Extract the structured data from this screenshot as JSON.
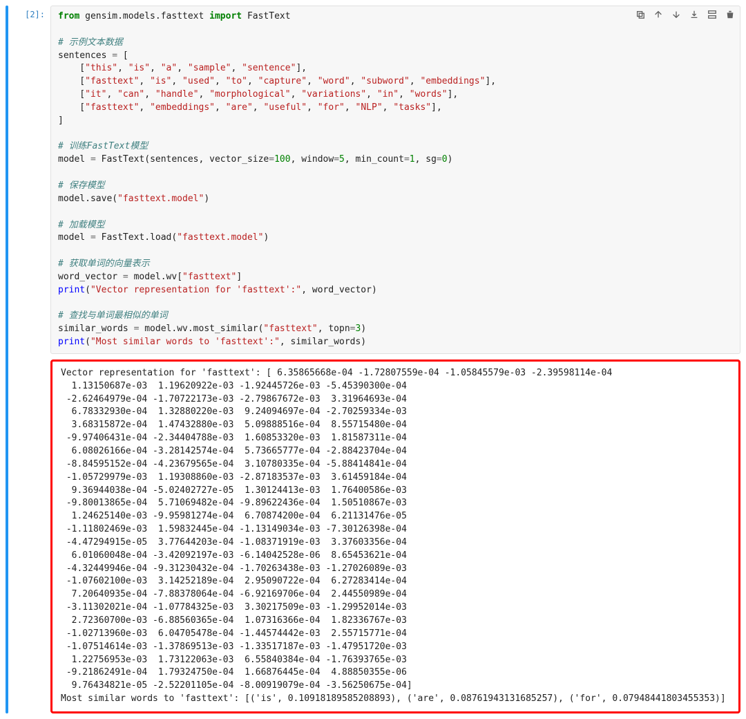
{
  "cell": {
    "prompt": "[2]:",
    "code_tokens": [
      {
        "t": "from",
        "c": "k-kw"
      },
      {
        "t": " gensim.models.fasttext ",
        "c": ""
      },
      {
        "t": "import",
        "c": "k-kw"
      },
      {
        "t": " FastText",
        "c": ""
      },
      {
        "t": "\n",
        "c": ""
      },
      {
        "t": "\n",
        "c": ""
      },
      {
        "t": "# 示例文本数据",
        "c": "k-com"
      },
      {
        "t": "\n",
        "c": ""
      },
      {
        "t": "sentences ",
        "c": ""
      },
      {
        "t": "=",
        "c": "k-op"
      },
      {
        "t": " [",
        "c": ""
      },
      {
        "t": "\n",
        "c": ""
      },
      {
        "t": "    [",
        "c": ""
      },
      {
        "t": "\"this\"",
        "c": "k-str"
      },
      {
        "t": ", ",
        "c": ""
      },
      {
        "t": "\"is\"",
        "c": "k-str"
      },
      {
        "t": ", ",
        "c": ""
      },
      {
        "t": "\"a\"",
        "c": "k-str"
      },
      {
        "t": ", ",
        "c": ""
      },
      {
        "t": "\"sample\"",
        "c": "k-str"
      },
      {
        "t": ", ",
        "c": ""
      },
      {
        "t": "\"sentence\"",
        "c": "k-str"
      },
      {
        "t": "],",
        "c": ""
      },
      {
        "t": "\n",
        "c": ""
      },
      {
        "t": "    [",
        "c": ""
      },
      {
        "t": "\"fasttext\"",
        "c": "k-str"
      },
      {
        "t": ", ",
        "c": ""
      },
      {
        "t": "\"is\"",
        "c": "k-str"
      },
      {
        "t": ", ",
        "c": ""
      },
      {
        "t": "\"used\"",
        "c": "k-str"
      },
      {
        "t": ", ",
        "c": ""
      },
      {
        "t": "\"to\"",
        "c": "k-str"
      },
      {
        "t": ", ",
        "c": ""
      },
      {
        "t": "\"capture\"",
        "c": "k-str"
      },
      {
        "t": ", ",
        "c": ""
      },
      {
        "t": "\"word\"",
        "c": "k-str"
      },
      {
        "t": ", ",
        "c": ""
      },
      {
        "t": "\"subword\"",
        "c": "k-str"
      },
      {
        "t": ", ",
        "c": ""
      },
      {
        "t": "\"embeddings\"",
        "c": "k-str"
      },
      {
        "t": "],",
        "c": ""
      },
      {
        "t": "\n",
        "c": ""
      },
      {
        "t": "    [",
        "c": ""
      },
      {
        "t": "\"it\"",
        "c": "k-str"
      },
      {
        "t": ", ",
        "c": ""
      },
      {
        "t": "\"can\"",
        "c": "k-str"
      },
      {
        "t": ", ",
        "c": ""
      },
      {
        "t": "\"handle\"",
        "c": "k-str"
      },
      {
        "t": ", ",
        "c": ""
      },
      {
        "t": "\"morphological\"",
        "c": "k-str"
      },
      {
        "t": ", ",
        "c": ""
      },
      {
        "t": "\"variations\"",
        "c": "k-str"
      },
      {
        "t": ", ",
        "c": ""
      },
      {
        "t": "\"in\"",
        "c": "k-str"
      },
      {
        "t": ", ",
        "c": ""
      },
      {
        "t": "\"words\"",
        "c": "k-str"
      },
      {
        "t": "],",
        "c": ""
      },
      {
        "t": "\n",
        "c": ""
      },
      {
        "t": "    [",
        "c": ""
      },
      {
        "t": "\"fasttext\"",
        "c": "k-str"
      },
      {
        "t": ", ",
        "c": ""
      },
      {
        "t": "\"embeddings\"",
        "c": "k-str"
      },
      {
        "t": ", ",
        "c": ""
      },
      {
        "t": "\"are\"",
        "c": "k-str"
      },
      {
        "t": ", ",
        "c": ""
      },
      {
        "t": "\"useful\"",
        "c": "k-str"
      },
      {
        "t": ", ",
        "c": ""
      },
      {
        "t": "\"for\"",
        "c": "k-str"
      },
      {
        "t": ", ",
        "c": ""
      },
      {
        "t": "\"NLP\"",
        "c": "k-str"
      },
      {
        "t": ", ",
        "c": ""
      },
      {
        "t": "\"tasks\"",
        "c": "k-str"
      },
      {
        "t": "],",
        "c": ""
      },
      {
        "t": "\n",
        "c": ""
      },
      {
        "t": "]",
        "c": ""
      },
      {
        "t": "\n",
        "c": ""
      },
      {
        "t": "\n",
        "c": ""
      },
      {
        "t": "# 训练FastText模型",
        "c": "k-com"
      },
      {
        "t": "\n",
        "c": ""
      },
      {
        "t": "model ",
        "c": ""
      },
      {
        "t": "=",
        "c": "k-op"
      },
      {
        "t": " FastText(sentences, vector_size",
        "c": ""
      },
      {
        "t": "=",
        "c": "k-op"
      },
      {
        "t": "100",
        "c": "k-num"
      },
      {
        "t": ", window",
        "c": ""
      },
      {
        "t": "=",
        "c": "k-op"
      },
      {
        "t": "5",
        "c": "k-num"
      },
      {
        "t": ", min_count",
        "c": ""
      },
      {
        "t": "=",
        "c": "k-op"
      },
      {
        "t": "1",
        "c": "k-num"
      },
      {
        "t": ", sg",
        "c": ""
      },
      {
        "t": "=",
        "c": "k-op"
      },
      {
        "t": "0",
        "c": "k-num"
      },
      {
        "t": ")",
        "c": ""
      },
      {
        "t": "\n",
        "c": ""
      },
      {
        "t": "\n",
        "c": ""
      },
      {
        "t": "# 保存模型",
        "c": "k-com"
      },
      {
        "t": "\n",
        "c": ""
      },
      {
        "t": "model.save(",
        "c": ""
      },
      {
        "t": "\"fasttext.model\"",
        "c": "k-str"
      },
      {
        "t": ")",
        "c": ""
      },
      {
        "t": "\n",
        "c": ""
      },
      {
        "t": "\n",
        "c": ""
      },
      {
        "t": "# 加载模型",
        "c": "k-com"
      },
      {
        "t": "\n",
        "c": ""
      },
      {
        "t": "model ",
        "c": ""
      },
      {
        "t": "=",
        "c": "k-op"
      },
      {
        "t": " FastText.load(",
        "c": ""
      },
      {
        "t": "\"fasttext.model\"",
        "c": "k-str"
      },
      {
        "t": ")",
        "c": ""
      },
      {
        "t": "\n",
        "c": ""
      },
      {
        "t": "\n",
        "c": ""
      },
      {
        "t": "# 获取单词的向量表示",
        "c": "k-com"
      },
      {
        "t": "\n",
        "c": ""
      },
      {
        "t": "word_vector ",
        "c": ""
      },
      {
        "t": "=",
        "c": "k-op"
      },
      {
        "t": " model.wv[",
        "c": ""
      },
      {
        "t": "\"fasttext\"",
        "c": "k-str"
      },
      {
        "t": "]",
        "c": ""
      },
      {
        "t": "\n",
        "c": ""
      },
      {
        "t": "print",
        "c": "k-fn"
      },
      {
        "t": "(",
        "c": ""
      },
      {
        "t": "\"Vector representation for 'fasttext':\"",
        "c": "k-str"
      },
      {
        "t": ", word_vector)",
        "c": ""
      },
      {
        "t": "\n",
        "c": ""
      },
      {
        "t": "\n",
        "c": ""
      },
      {
        "t": "# 查找与单词最相似的单词",
        "c": "k-com"
      },
      {
        "t": "\n",
        "c": ""
      },
      {
        "t": "similar_words ",
        "c": ""
      },
      {
        "t": "=",
        "c": "k-op"
      },
      {
        "t": " model.wv.most_similar(",
        "c": ""
      },
      {
        "t": "\"fasttext\"",
        "c": "k-str"
      },
      {
        "t": ", topn",
        "c": ""
      },
      {
        "t": "=",
        "c": "k-op"
      },
      {
        "t": "3",
        "c": "k-num"
      },
      {
        "t": ")",
        "c": ""
      },
      {
        "t": "\n",
        "c": ""
      },
      {
        "t": "print",
        "c": "k-fn"
      },
      {
        "t": "(",
        "c": ""
      },
      {
        "t": "\"Most similar words to 'fasttext':\"",
        "c": "k-str"
      },
      {
        "t": ", similar_words)",
        "c": ""
      }
    ],
    "output": "Vector representation for 'fasttext': [ 6.35865668e-04 -1.72807559e-04 -1.05845579e-03 -2.39598114e-04\n  1.13150687e-03  1.19620922e-03 -1.92445726e-03 -5.45390300e-04\n -2.62464979e-04 -1.70722173e-03 -2.79867672e-03  3.31964693e-04\n  6.78332930e-04  1.32880220e-03  9.24094697e-04 -2.70259334e-03\n  3.68315872e-04  1.47432880e-03  5.09888516e-04  8.55715480e-04\n -9.97406431e-04 -2.34404788e-03  1.60853320e-03  1.81587311e-04\n  6.08026166e-04 -3.28142574e-04  5.73665777e-04 -2.88423704e-04\n -8.84595152e-04 -4.23679565e-04  3.10780335e-04 -5.88414841e-04\n -1.05729979e-03  1.19308860e-03 -2.87183537e-03  3.61459184e-04\n  9.36944038e-04 -5.02402727e-05  1.30124413e-03  1.76400586e-03\n -9.80013865e-04  5.71069482e-04 -9.89622436e-04  1.50510867e-03\n  1.24625140e-03 -9.95981274e-04  6.70874200e-04  6.21131476e-05\n -1.11802469e-03  1.59832445e-04 -1.13149034e-03 -7.30126398e-04\n -4.47294915e-05  3.77644203e-04 -1.08371919e-03  3.37603356e-04\n  6.01060048e-04 -3.42092197e-03 -6.14042528e-06  8.65453621e-04\n -4.32449946e-04 -9.31230432e-04 -1.70263438e-03 -1.27026089e-03\n -1.07602100e-03  3.14252189e-04  2.95090722e-04  6.27283414e-04\n  7.20640935e-04 -7.88378064e-04 -6.92169706e-04  2.44550989e-04\n -3.11302021e-04 -1.07784325e-03  3.30217509e-03 -1.29952014e-03\n  2.72360700e-03 -6.88560365e-04  1.07316366e-04  1.82336767e-03\n -1.02713960e-03  6.04705478e-04 -1.44574442e-03  2.55715771e-04\n -1.07514614e-03 -1.37869513e-03 -1.33517187e-03 -1.47951720e-03\n  1.22756953e-03  1.73122063e-03  6.55840384e-04 -1.76393765e-03\n -9.21862491e-04  1.79324750e-04  1.66876445e-04  4.88850355e-06\n  9.76434821e-05 -2.52201105e-04 -8.00919079e-04 -3.56250675e-04]\nMost similar words to 'fasttext': [('is', 0.10918189585208893), ('are', 0.08761943131685257), ('for', 0.07948441803455353)]"
  },
  "toolbar": {
    "duplicate": "duplicate",
    "up": "move up",
    "down": "move down",
    "download": "download",
    "insert_below": "insert below",
    "delete": "delete"
  }
}
